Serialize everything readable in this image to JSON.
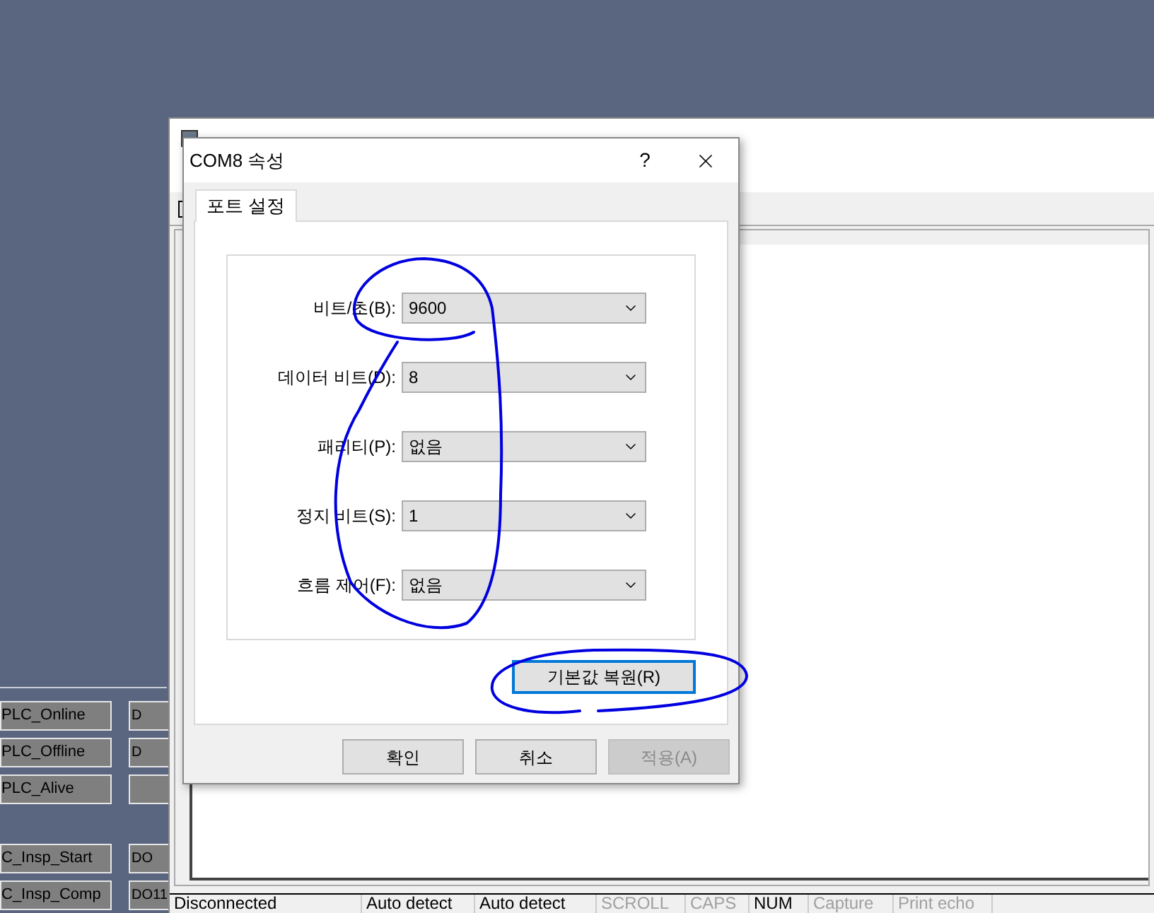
{
  "left_panel": {
    "rows": [
      {
        "label": "PLC_Online",
        "label_2": "D"
      },
      {
        "label": "PLC_Offline",
        "label_2": "D"
      },
      {
        "label": "PLC_Alive"
      },
      {
        "label": "C_Insp_Start",
        "label_2": "DO"
      },
      {
        "label": "C_Insp_Comp",
        "label_2": "DO11"
      }
    ]
  },
  "terminal": {
    "status_bar": [
      {
        "text": "Disconnected",
        "disabled": false
      },
      {
        "text": "Auto detect",
        "disabled": false
      },
      {
        "text": "Auto detect",
        "disabled": false
      },
      {
        "text": "SCROLL",
        "disabled": true
      },
      {
        "text": "CAPS",
        "disabled": true
      },
      {
        "text": "NUM",
        "disabled": false
      },
      {
        "text": "Capture",
        "disabled": true
      },
      {
        "text": "Print echo",
        "disabled": true
      }
    ]
  },
  "dialog": {
    "title": "COM8 속성",
    "help": "?",
    "tabs": [
      {
        "label": "포트 설정",
        "selected": true
      }
    ],
    "fields": [
      {
        "label": "비트/초(B):",
        "value": "9600"
      },
      {
        "label": "데이터 비트(D):",
        "value": "8"
      },
      {
        "label": "패리티(P):",
        "value": "없음"
      },
      {
        "label": "정지 비트(S):",
        "value": "1"
      },
      {
        "label": "흐름 제어(F):",
        "value": "없음"
      }
    ],
    "restore_button": "기본값 복원(R)",
    "buttons": [
      {
        "label": "확인",
        "disabled": false
      },
      {
        "label": "취소",
        "disabled": false
      },
      {
        "label": "적용(A)",
        "disabled": true
      }
    ]
  }
}
